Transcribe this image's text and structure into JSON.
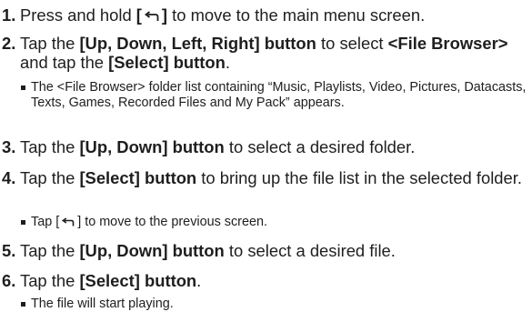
{
  "steps": [
    {
      "number": "1.",
      "parts": [
        "Press and hold ",
        "[",
        "]",
        " to move to the main menu screen."
      ]
    },
    {
      "number": "2.",
      "parts": [
        "Tap the ",
        "[Up, Down, Left, Right] button",
        " to select ",
        "<File Browser>",
        " and tap the ",
        "[Select] button",
        "."
      ],
      "note": "The <File Browser> folder list containing “Music, Playlists, Video, Pictures, Datacasts, Texts, Games, Recorded Files and My Pack” appears."
    },
    {
      "number": "3.",
      "parts": [
        "Tap the ",
        "[Up, Down] button",
        " to select a desired folder."
      ]
    },
    {
      "number": "4.",
      "parts": [
        "Tap the ",
        "[Select] button",
        " to bring up the file list in the selected folder."
      ],
      "note_parts": [
        "Tap [",
        "] to move to the previous screen."
      ]
    },
    {
      "number": "5.",
      "parts": [
        "Tap the ",
        "[Up, Down] button",
        " to select a desired file."
      ]
    },
    {
      "number": "6.",
      "parts": [
        "Tap the ",
        "[Select] button",
        "."
      ],
      "note": "The file will start playing."
    }
  ],
  "icons": {
    "back": "back-arrow-icon"
  }
}
